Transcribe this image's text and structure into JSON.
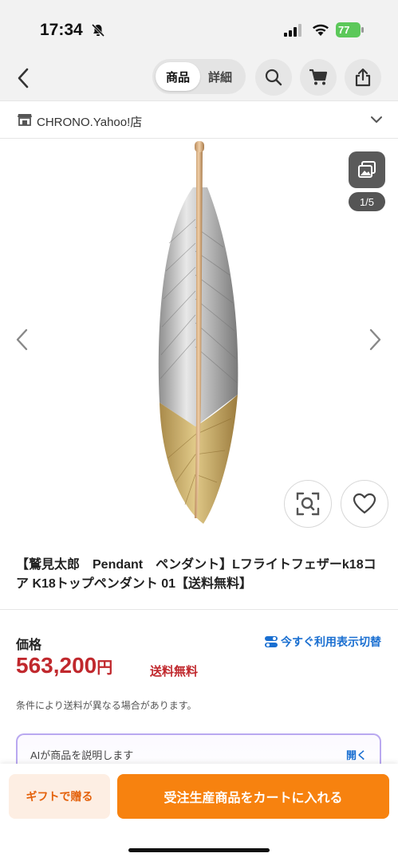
{
  "status": {
    "time": "17:34",
    "battery": "77"
  },
  "nav": {
    "tab_product": "商品",
    "tab_detail": "詳細"
  },
  "store": {
    "name": "CHRONO.Yahoo!店"
  },
  "gallery": {
    "counter": "1/5"
  },
  "product": {
    "title": "【鷲見太郎　Pendant　ペンダント】Lフライトフェザーk18コア K18トップペンダント 01【送料無料】"
  },
  "price": {
    "label": "価格",
    "toggle_label": "今すぐ利用表示切替",
    "value": "563,200",
    "unit": "円",
    "shipping": "送料無料",
    "note": "条件により送料が異なる場合があります。"
  },
  "ai": {
    "text": "AIが商品を説明します",
    "open": "開く"
  },
  "bottom": {
    "gift_label": "ギフトで贈る",
    "cart_label": "受注生産商品をカートに入れる"
  },
  "colors": {
    "accent_orange": "#f7820f",
    "price_red": "#c0282d",
    "link_blue": "#1a6fd1"
  }
}
